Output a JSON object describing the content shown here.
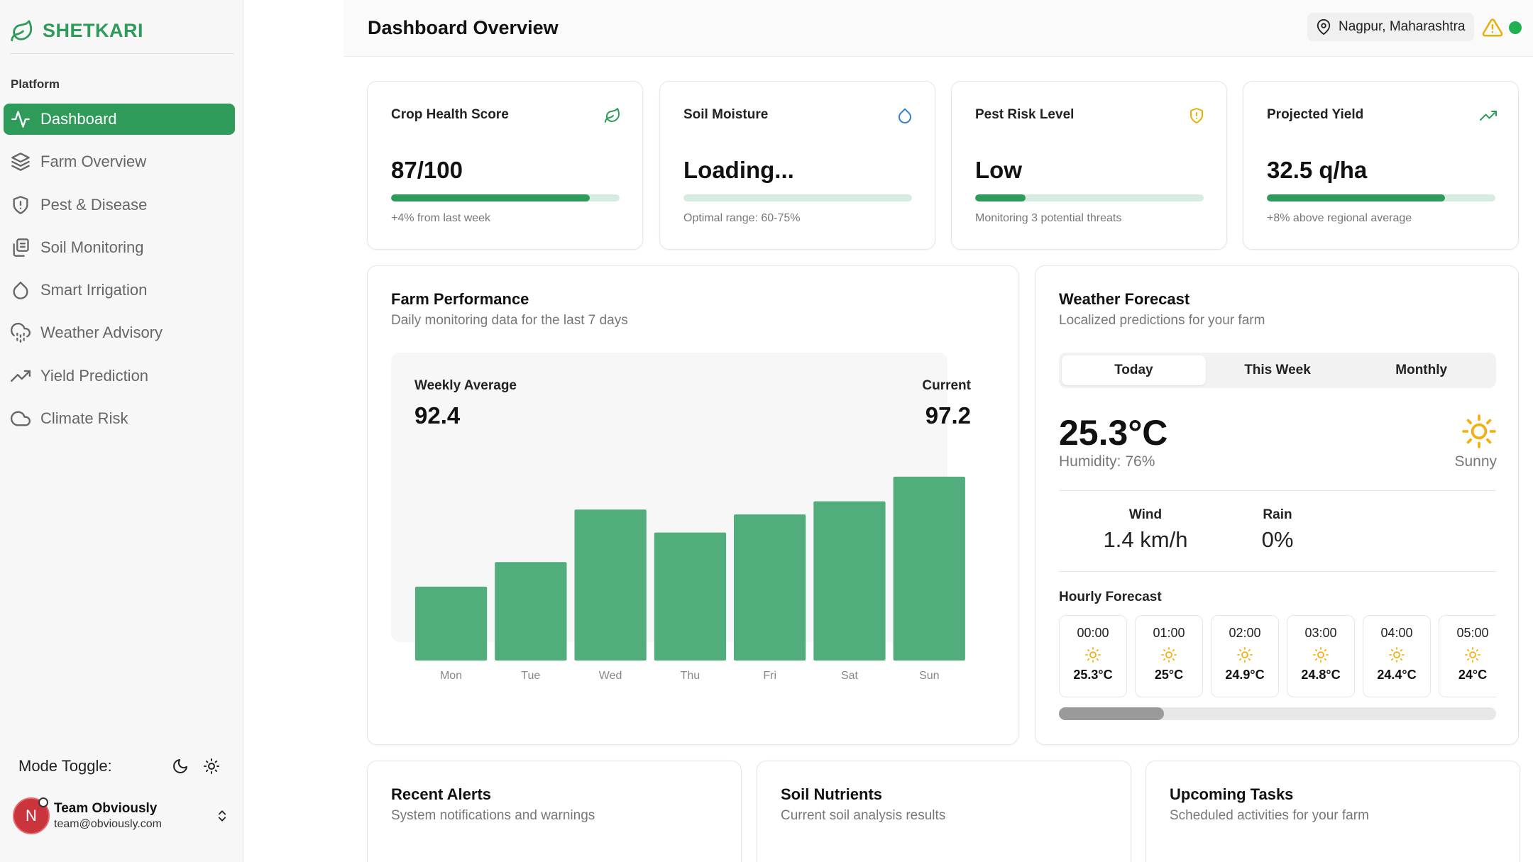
{
  "brand": {
    "name": "SHETKARI"
  },
  "sidebar": {
    "section_label": "Platform",
    "items": [
      {
        "label": "Dashboard",
        "icon": "activity-icon",
        "active": true
      },
      {
        "label": "Farm Overview",
        "icon": "layers-icon"
      },
      {
        "label": "Pest & Disease",
        "icon": "shield-icon"
      },
      {
        "label": "Soil Monitoring",
        "icon": "files-icon"
      },
      {
        "label": "Smart Irrigation",
        "icon": "droplet-icon"
      },
      {
        "label": "Weather Advisory",
        "icon": "cloud-rain-icon"
      },
      {
        "label": "Yield Prediction",
        "icon": "trending-up-icon"
      },
      {
        "label": "Climate Risk",
        "icon": "cloud-icon"
      }
    ],
    "mode_toggle_label": "Mode Toggle:",
    "user": {
      "initial": "N",
      "name": "Team Obviously",
      "email": "team@obviously.com"
    }
  },
  "header": {
    "title": "Dashboard Overview",
    "location": "Nagpur, Maharashtra",
    "status_color": "#1fb150",
    "warning_color": "#e8b007"
  },
  "stats": [
    {
      "title": "Crop Health Score",
      "value": "87/100",
      "progress": 0.87,
      "note": "+4% from last week",
      "icon": "leaf-icon"
    },
    {
      "title": "Soil Moisture",
      "value": "Loading...",
      "progress": 0,
      "note": "Optimal range: 60-75%",
      "icon": "droplet-icon"
    },
    {
      "title": "Pest Risk Level",
      "value": "Low",
      "progress": 0.22,
      "note": "Monitoring 3 potential threats",
      "icon": "shield-alert-icon"
    },
    {
      "title": "Projected Yield",
      "value": "32.5 q/ha",
      "progress": 0.78,
      "note": "+8% above regional average",
      "icon": "trending-up-icon"
    }
  ],
  "performance": {
    "title": "Farm Performance",
    "subtitle": "Daily monitoring data for the last 7 days",
    "avg_label": "Weekly Average",
    "avg_value": "92.4",
    "current_label": "Current",
    "current_value": "97.2"
  },
  "chart_data": {
    "type": "bar",
    "categories": [
      "Mon",
      "Tue",
      "Wed",
      "Thu",
      "Fri",
      "Sat",
      "Sun"
    ],
    "values": [
      88.5,
      90.0,
      93.2,
      91.8,
      92.9,
      93.7,
      95.2
    ],
    "ylim": [
      84,
      95.5
    ],
    "color": "#52ad7d",
    "grid": false
  },
  "weather": {
    "title": "Weather Forecast",
    "subtitle": "Localized predictions for your farm",
    "tabs": [
      "Today",
      "This Week",
      "Monthly"
    ],
    "active_tab": 0,
    "temperature": "25.3°C",
    "humidity": "Humidity: 76%",
    "condition": "Sunny",
    "wind_label": "Wind",
    "wind_value": "1.4 km/h",
    "rain_label": "Rain",
    "rain_value": "0%",
    "hourly_title": "Hourly Forecast",
    "hourly": [
      {
        "time": "00:00",
        "temp": "25.3°C"
      },
      {
        "time": "01:00",
        "temp": "25°C"
      },
      {
        "time": "02:00",
        "temp": "24.9°C"
      },
      {
        "time": "03:00",
        "temp": "24.8°C"
      },
      {
        "time": "04:00",
        "temp": "24.4°C"
      },
      {
        "time": "05:00",
        "temp": "24°C"
      }
    ],
    "sun_color": "#f2b111"
  },
  "bottom_cards": [
    {
      "title": "Recent Alerts",
      "subtitle": "System notifications and warnings"
    },
    {
      "title": "Soil Nutrients",
      "subtitle": "Current soil analysis results"
    },
    {
      "title": "Upcoming Tasks",
      "subtitle": "Scheduled activities for your farm"
    }
  ]
}
